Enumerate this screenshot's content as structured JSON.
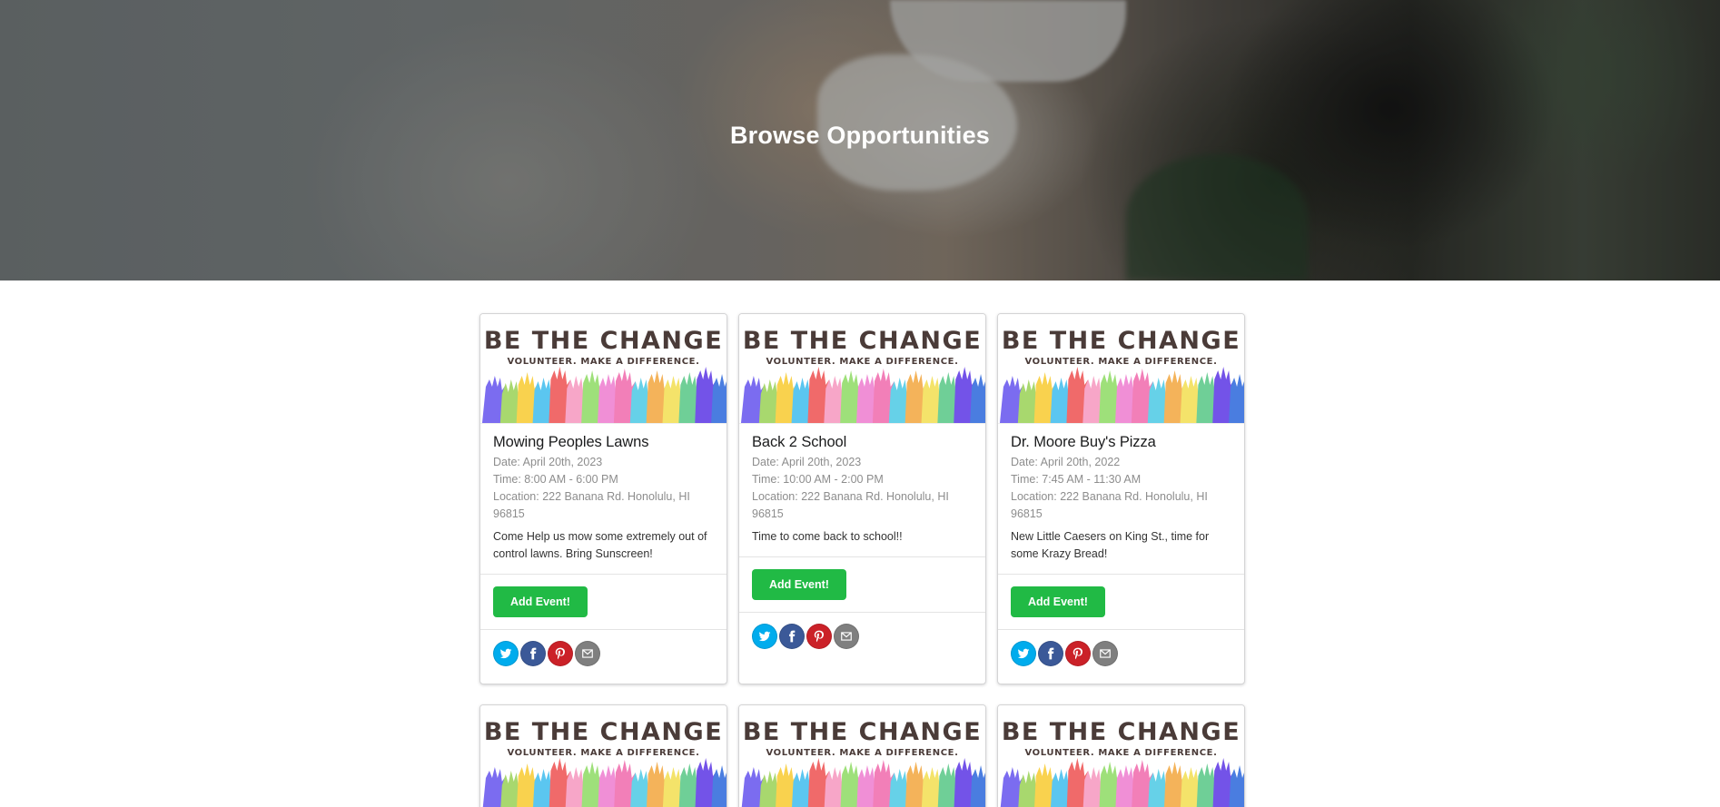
{
  "hero": {
    "title": "Browse Opportunities"
  },
  "banner": {
    "headline": "BE THE CHANGE",
    "tagline": "VOLUNTEER. MAKE A DIFFERENCE."
  },
  "cards": [
    {
      "title": "Mowing Peoples Lawns",
      "date": "Date: April 20th, 2023",
      "time": "Time: 8:00 AM - 6:00 PM",
      "location": "Location: 222 Banana Rd. Honolulu, HI 96815",
      "description": "Come Help us mow some extremely out of control lawns. Bring Sunscreen!",
      "button": "Add Event!"
    },
    {
      "title": "Back 2 School",
      "date": "Date: April 20th, 2023",
      "time": "Time: 10:00 AM - 2:00 PM",
      "location": "Location: 222 Banana Rd. Honolulu, HI 96815",
      "description": "Time to come back to school!!",
      "button": "Add Event!"
    },
    {
      "title": "Dr. Moore Buy's Pizza",
      "date": "Date: April 20th, 2022",
      "time": "Time: 7:45 AM - 11:30 AM",
      "location": "Location: 222 Banana Rd. Honolulu, HI 96815",
      "description": "New Little Caesers on King St., time for some Krazy Bread!",
      "button": "Add Event!"
    }
  ],
  "share_icons": [
    "twitter-icon",
    "facebook-icon",
    "pinterest-icon",
    "email-icon"
  ],
  "colors": {
    "button": "#21ba45",
    "twitter": "#00aced",
    "facebook": "#3b5998",
    "pinterest": "#cb2128",
    "email": "#7f7f7f"
  }
}
